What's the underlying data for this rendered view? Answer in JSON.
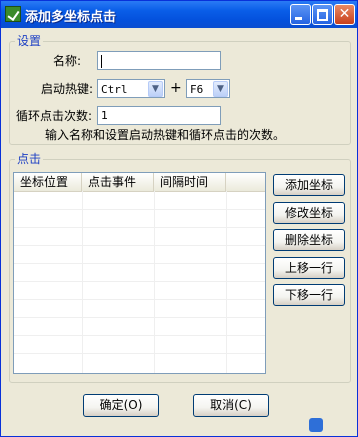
{
  "window": {
    "title": "添加多坐标点击",
    "controls": {
      "minimize": "minimize",
      "maximize": "maximize",
      "close": "✕"
    }
  },
  "settings": {
    "legend": "设置",
    "name_label": "名称:",
    "name_value": "",
    "hotkey_label": "启动热键:",
    "hotkey_modifier": "Ctrl",
    "plus": "+",
    "hotkey_key": "F6",
    "loop_label": "循环点击次数:",
    "loop_value": "1",
    "hint": "输入名称和设置启动热键和循环点击的次数。"
  },
  "click": {
    "legend": "点击",
    "columns": [
      "坐标位置",
      "点击事件",
      "间隔时间"
    ],
    "rows": []
  },
  "side_buttons": {
    "add": "添加坐标",
    "edit": "修改坐标",
    "delete": "删除坐标",
    "up": "上移一行",
    "down": "下移一行"
  },
  "footer": {
    "ok": "确定(O)",
    "cancel": "取消(C)"
  },
  "icons": {
    "app": "app-icon",
    "dropdown": "chevron-down-icon"
  }
}
